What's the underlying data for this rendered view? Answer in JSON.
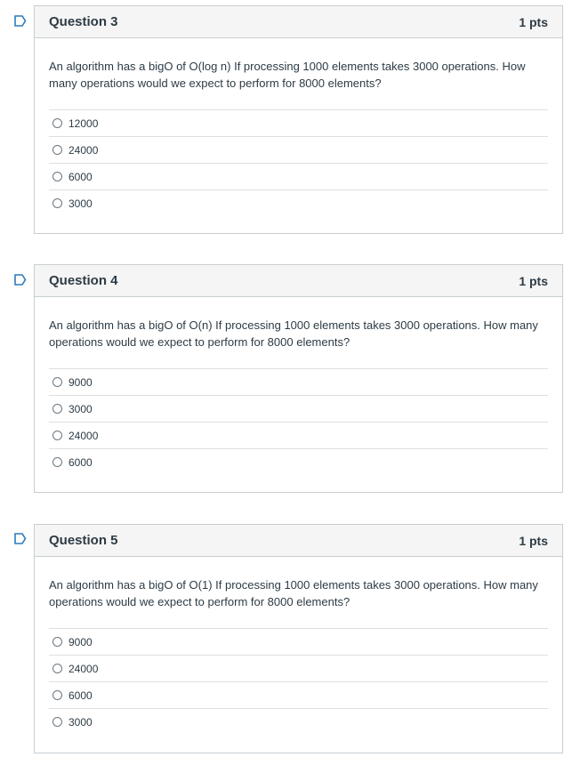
{
  "questions": [
    {
      "title": "Question 3",
      "points": "1 pts",
      "text": "An algorithm has a bigO of  O(log n)    If processing 1000 elements takes 3000 operations.  How many operations would we expect to perform for 8000 elements?",
      "answers": [
        "12000",
        "24000",
        "6000",
        "3000"
      ]
    },
    {
      "title": "Question 4",
      "points": "1 pts",
      "text": "An algorithm has a bigO of  O(n)    If processing 1000 elements takes 3000 operations.  How many operations would we expect to perform for 8000 elements?",
      "answers": [
        "9000",
        "3000",
        "24000",
        "6000"
      ]
    },
    {
      "title": "Question 5",
      "points": "1 pts",
      "text": "An algorithm has a bigO of  O(1)    If processing 1000 elements takes 3000 operations.  How many operations would we expect to perform for 8000 elements?",
      "answers": [
        "9000",
        "24000",
        "6000",
        "3000"
      ]
    }
  ],
  "colors": {
    "flag": "#2b7abc",
    "header_bg": "#f5f5f5",
    "border": "#c7cdd1",
    "text": "#2d3b45"
  }
}
